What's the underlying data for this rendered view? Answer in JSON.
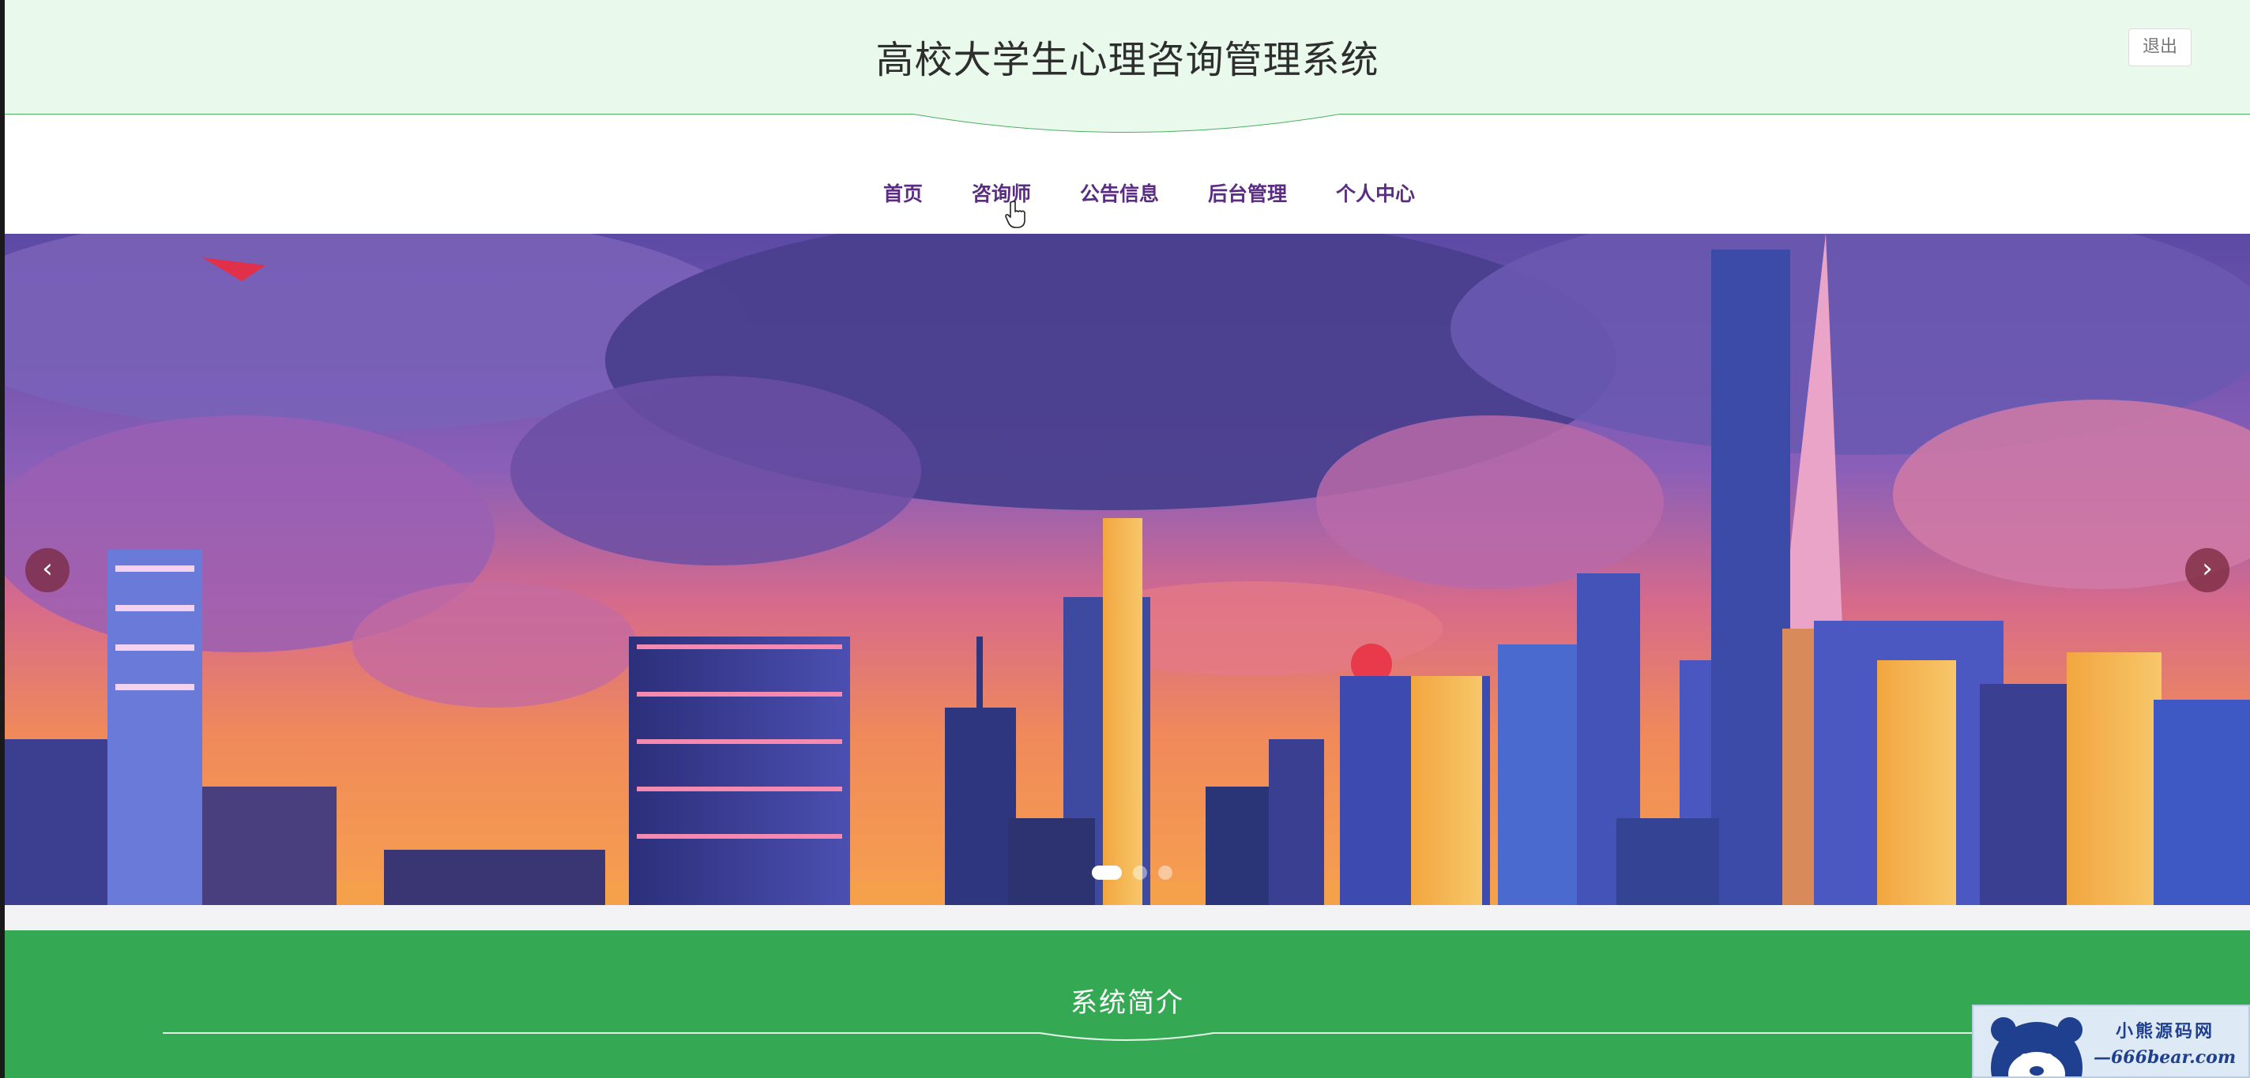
{
  "header": {
    "title": "高校大学生心理咨询管理系统",
    "logout_label": "退出"
  },
  "nav": {
    "items": [
      {
        "label": "首页"
      },
      {
        "label": "咨询师"
      },
      {
        "label": "公告信息"
      },
      {
        "label": "后台管理"
      },
      {
        "label": "个人中心"
      }
    ],
    "active_index": 0,
    "hover_index": 1
  },
  "carousel": {
    "prev_icon": "chevron-left-icon",
    "next_icon": "chevron-right-icon",
    "prev_glyph": "‹",
    "next_glyph": "›",
    "slide_count": 3,
    "active_slide": 0
  },
  "intro": {
    "title": "系统简介"
  },
  "watermark": {
    "line1": "小熊源码网",
    "line2": "—666bear.com—"
  },
  "colors": {
    "header_bg": "#e9f9ec",
    "accent_green": "#34a853",
    "nav_text": "#5a2d82"
  }
}
